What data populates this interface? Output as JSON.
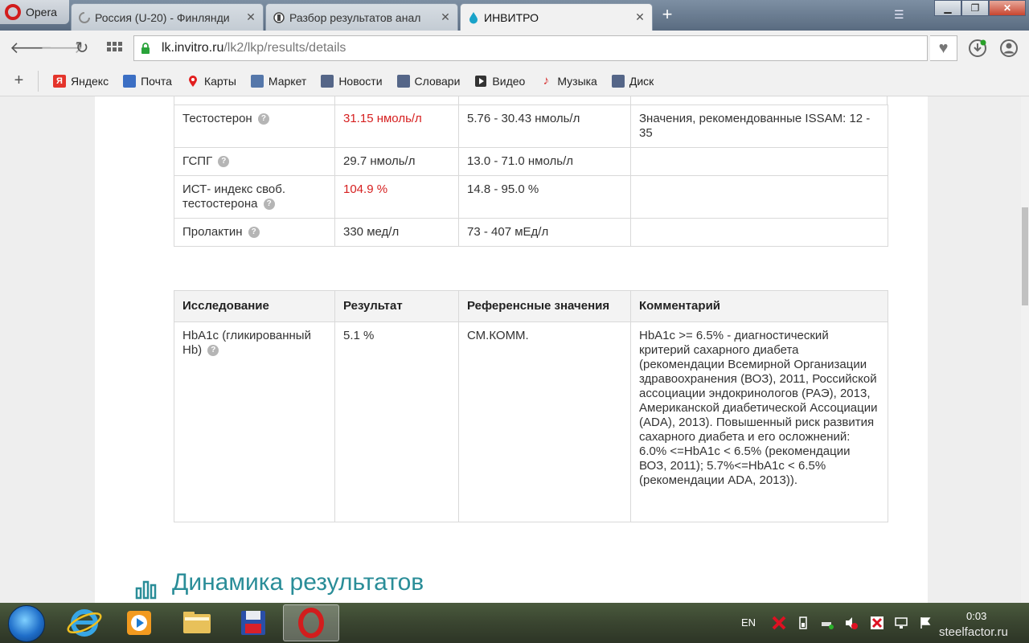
{
  "browser": {
    "menu_label": "Opera",
    "tabs": [
      {
        "title": "Россия (U-20) - Финлянди"
      },
      {
        "title": "Разбор результатов анал"
      },
      {
        "title": "ИНВИТРО"
      }
    ],
    "new_tab": "+",
    "url_host": "lk.invitro.ru",
    "url_path": "/lk2/lkp/results/details",
    "bookmarks": [
      {
        "label": "Яндекс",
        "icon": "yandex-icon",
        "color": "#e4342b"
      },
      {
        "label": "Почта",
        "icon": "mail-icon",
        "color": "#3c6fc4"
      },
      {
        "label": "Карты",
        "icon": "map-pin-icon",
        "color": "#e21f1f"
      },
      {
        "label": "Маркет",
        "icon": "market-icon",
        "color": "#5577aa"
      },
      {
        "label": "Новости",
        "icon": "news-icon",
        "color": "#556688"
      },
      {
        "label": "Словари",
        "icon": "dictionary-icon",
        "color": "#556688"
      },
      {
        "label": "Видео",
        "icon": "video-icon",
        "color": "#333333"
      },
      {
        "label": "Музыка",
        "icon": "music-icon",
        "color": "#d52a2a"
      },
      {
        "label": "Диск",
        "icon": "disk-icon",
        "color": "#556688"
      }
    ]
  },
  "table1": {
    "rows": [
      {
        "name": "Тестостерон",
        "result": "31.15 нмоль/л",
        "result_high": true,
        "reference": "5.76 - 30.43 нмоль/л",
        "comment": "Значения, рекомендованные ISSAM: 12 - 35"
      },
      {
        "name": "ГСПГ",
        "result": "29.7 нмоль/л",
        "result_high": false,
        "reference": "13.0 - 71.0 нмоль/л",
        "comment": ""
      },
      {
        "name": "ИСТ- индекс своб. тестостерона",
        "result": "104.9 %",
        "result_high": true,
        "reference": "14.8 - 95.0 %",
        "comment": ""
      },
      {
        "name": "Пролактин",
        "result": "330 мед/л",
        "result_high": false,
        "reference": "73 - 407 мЕд/л",
        "comment": ""
      }
    ]
  },
  "table2": {
    "headers": {
      "name": "Исследование",
      "result": "Результат",
      "reference": "Референсные значения",
      "comment": "Комментарий"
    },
    "rows": [
      {
        "name": "HbA1c (гликированный Hb)",
        "result": "5.1 %",
        "reference": "СМ.КОММ.",
        "comment": "HbA1c >= 6.5% - диагностический критерий сахарного диабета (рекомендации Всемирной Организации здравоохранения (ВОЗ), 2011, Российской ассоциации эндокринологов (РАЭ), 2013, Американской диабетической Ассоциации (ADA), 2013). Повышенный риск развития сахарного диабета и его осложнений: 6.0% <=HbA1c < 6.5% (рекомендации ВОЗ, 2011); 5.7%<=HbA1c < 6.5% (рекомендации ADA, 2013))."
      }
    ]
  },
  "dynamics_title": "Динамика результатов",
  "taskbar": {
    "language": "EN",
    "time": "0:03"
  },
  "watermark": "steelfactor.ru",
  "colors": {
    "accent": "#2a8d98",
    "high_value": "#d62020"
  }
}
